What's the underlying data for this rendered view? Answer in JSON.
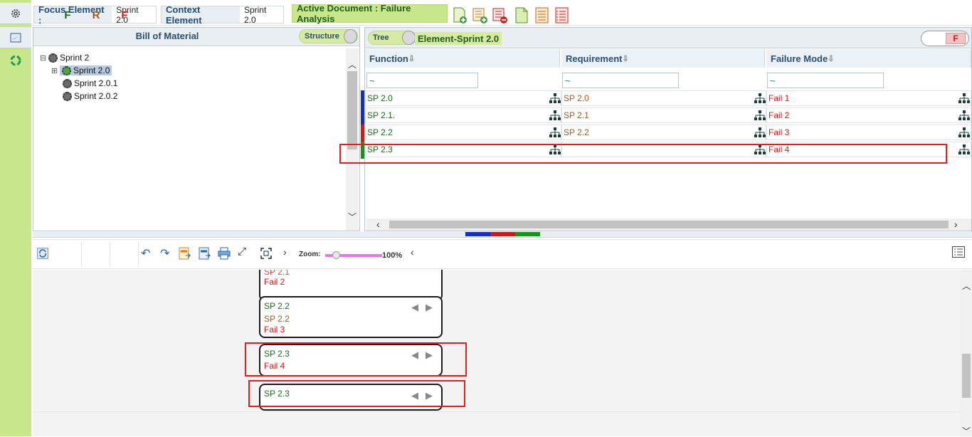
{
  "top": {
    "focus_label": "Focus Element :",
    "focus_value": "Sprint 2.0",
    "context_label": "Context Element",
    "context_value": "Sprint 2.0",
    "active_doc": "Active Document : Failure Analysis"
  },
  "bom": {
    "title": "Bill of Material",
    "toggle_label": "Structure",
    "tree": [
      {
        "label": "Sprint 2",
        "level": 0,
        "expander": "⊟"
      },
      {
        "label": "Sprint 2.0",
        "level": 1,
        "expander": "⊞",
        "selected": true
      },
      {
        "label": "Sprint 2.0.1",
        "level": 1,
        "expander": ""
      },
      {
        "label": "Sprint 2.0.2",
        "level": 1,
        "expander": ""
      }
    ]
  },
  "grid": {
    "toggle_label": "Tree",
    "element_label": "Element-Sprint 2.0",
    "f_badge": "F",
    "columns": [
      "Function",
      "Requirement",
      "Failure Mode"
    ],
    "filter_value": "~",
    "rows": [
      {
        "function": "SP 2.0",
        "requirement": "SP 2.0",
        "failure": "Fail 1",
        "color": "#1030c8"
      },
      {
        "function": "SP 2.1.",
        "requirement": "SP 2.1",
        "failure": "Fail 2",
        "color": "#1030c8"
      },
      {
        "function": "SP 2.2",
        "requirement": "SP 2.2",
        "failure": "Fail 3",
        "color": "#d01818"
      },
      {
        "function": "SP 2.3",
        "requirement": "",
        "failure": "Fail 4",
        "color": "#119911"
      }
    ]
  },
  "toolbar2": {
    "f_green": "F",
    "r_brown": "R",
    "f_red": "F",
    "zoom_label": "Zoom:",
    "zoom_value": "100%"
  },
  "canvas": {
    "partial_node_fail": "Fail 2",
    "node1": {
      "function": "SP 2.2",
      "requirement": "SP 2.2",
      "failure": "Fail 3"
    },
    "node2": {
      "function": "SP 2.3",
      "failure": "Fail 4"
    },
    "node3": {
      "function": "SP 2.3"
    }
  },
  "colors": {
    "rail": "#c8e68c",
    "accent_green": "#1a6b1a",
    "accent_red": "#d11818",
    "accent_brown": "#9a5b1f"
  }
}
